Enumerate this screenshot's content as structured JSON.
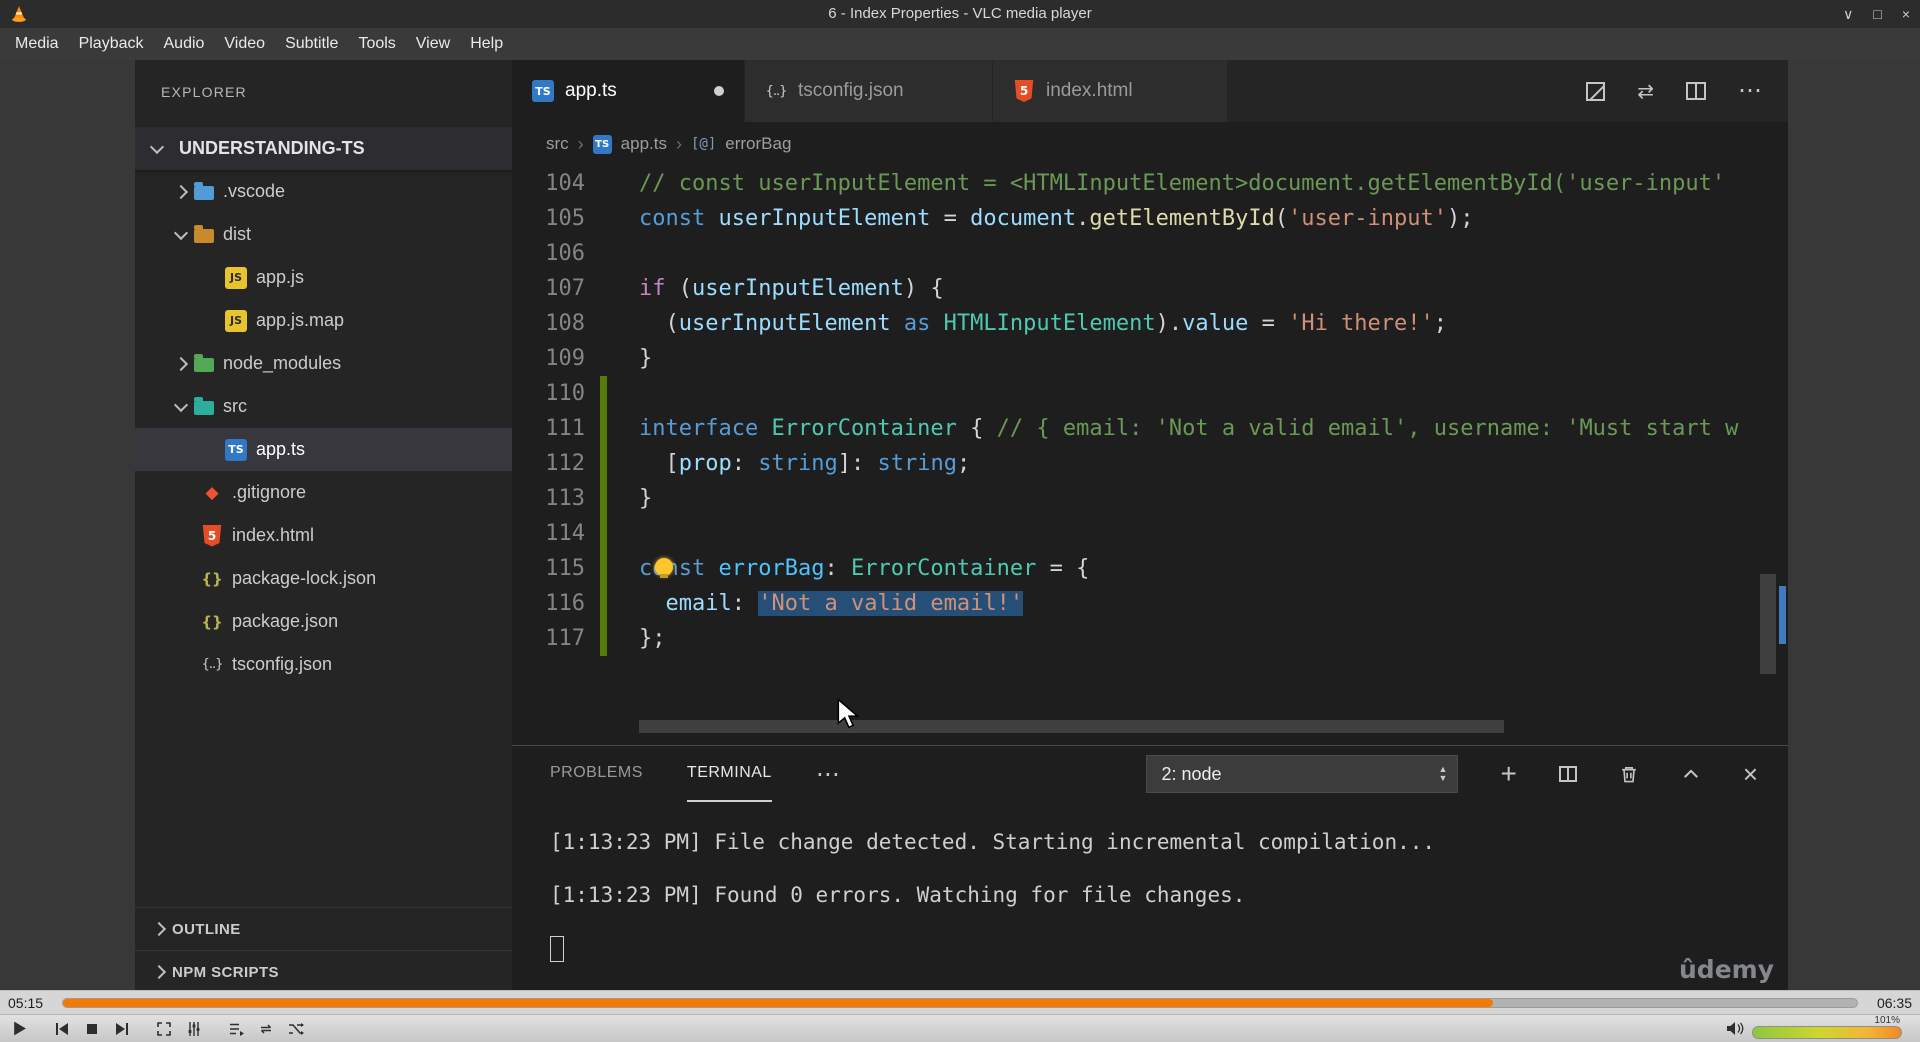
{
  "vlc": {
    "title": "6 - Index Properties - VLC media player",
    "menu_items": [
      "Media",
      "Playback",
      "Audio",
      "Video",
      "Subtitle",
      "Tools",
      "View",
      "Help"
    ],
    "time_current": "05:15",
    "time_total": "06:35",
    "progress_percent": 79.7,
    "volume_percent": "101%"
  },
  "icons": {
    "minimize_glyph": "∨",
    "maximize_glyph": "□",
    "close_glyph": "×",
    "ellipsis": "⋯",
    "compare_glyph": "⇄",
    "plus": "+",
    "spinner_up": "▲",
    "spinner_down": "▼",
    "chevron_sep": "›",
    "symbol_field": "[@]",
    "git_diamond": "◆",
    "json_braces": "{}",
    "config_braces": "{..}"
  },
  "colors": {
    "accent_orange": "#f57900",
    "selection_blue": "#264f78",
    "modified_green": "#587c0c"
  },
  "vscode": {
    "explorer": {
      "header": "EXPLORER",
      "tree": [
        {
          "label": "UNDERSTANDING-TS",
          "depth": 0,
          "root": true,
          "chevron": "down"
        },
        {
          "label": ".vscode",
          "depth": 1,
          "icon": "folder-blue",
          "chevron": "right"
        },
        {
          "label": "dist",
          "depth": 1,
          "icon": "folder-orange",
          "chevron": "down"
        },
        {
          "label": "app.js",
          "depth": 2,
          "icon": "js"
        },
        {
          "label": "app.js.map",
          "depth": 2,
          "icon": "js"
        },
        {
          "label": "node_modules",
          "depth": 1,
          "icon": "folder-green",
          "chevron": "right"
        },
        {
          "label": "src",
          "depth": 1,
          "icon": "folder-teal",
          "chevron": "down"
        },
        {
          "label": "app.ts",
          "depth": 2,
          "icon": "ts",
          "selected": true
        },
        {
          "label": ".gitignore",
          "depth": 1,
          "icon": "git"
        },
        {
          "label": "index.html",
          "depth": 1,
          "icon": "html"
        },
        {
          "label": "package-lock.json",
          "depth": 1,
          "icon": "json"
        },
        {
          "label": "package.json",
          "depth": 1,
          "icon": "json"
        },
        {
          "label": "tsconfig.json",
          "depth": 1,
          "icon": "braces"
        }
      ],
      "sections": [
        "OUTLINE",
        "NPM SCRIPTS"
      ]
    },
    "tabs": [
      {
        "label": "app.ts",
        "icon": "ts",
        "active": true,
        "modified": true
      },
      {
        "label": "tsconfig.json",
        "icon": "braces"
      },
      {
        "label": "index.html",
        "icon": "html"
      }
    ],
    "breadcrumb": [
      {
        "label": "src"
      },
      {
        "label": "app.ts",
        "icon": "ts"
      },
      {
        "label": "errorBag",
        "icon": "symbol"
      }
    ],
    "editor": {
      "lines": [
        {
          "n": "104",
          "tokens": [
            {
              "c": "comment",
              "t": "// const userInputElement = <HTMLInputElement>document.getElementById('user-input'"
            }
          ]
        },
        {
          "n": "105",
          "tokens": [
            {
              "c": "kw",
              "t": "const"
            },
            {
              "c": "plain",
              "t": " "
            },
            {
              "c": "var",
              "t": "userInputElement"
            },
            {
              "c": "plain",
              "t": " = "
            },
            {
              "c": "var",
              "t": "document"
            },
            {
              "c": "plain",
              "t": "."
            },
            {
              "c": "fn",
              "t": "getElementById"
            },
            {
              "c": "plain",
              "t": "("
            },
            {
              "c": "str",
              "t": "'user-input'"
            },
            {
              "c": "plain",
              "t": ");"
            }
          ]
        },
        {
          "n": "106",
          "tokens": []
        },
        {
          "n": "107",
          "tokens": [
            {
              "c": "ctrl",
              "t": "if"
            },
            {
              "c": "plain",
              "t": " ("
            },
            {
              "c": "var",
              "t": "userInputElement"
            },
            {
              "c": "plain",
              "t": ") {"
            }
          ]
        },
        {
          "n": "108",
          "tokens": [
            {
              "c": "plain",
              "t": "  ("
            },
            {
              "c": "var",
              "t": "userInputElement"
            },
            {
              "c": "plain",
              "t": " "
            },
            {
              "c": "kw",
              "t": "as"
            },
            {
              "c": "plain",
              "t": " "
            },
            {
              "c": "type",
              "t": "HTMLInputElement"
            },
            {
              "c": "plain",
              "t": ")."
            },
            {
              "c": "var",
              "t": "value"
            },
            {
              "c": "plain",
              "t": " = "
            },
            {
              "c": "str",
              "t": "'Hi there!'"
            },
            {
              "c": "plain",
              "t": ";"
            }
          ]
        },
        {
          "n": "109",
          "tokens": [
            {
              "c": "plain",
              "t": "}"
            }
          ]
        },
        {
          "n": "110",
          "tokens": []
        },
        {
          "n": "111",
          "tokens": [
            {
              "c": "kw",
              "t": "interface"
            },
            {
              "c": "plain",
              "t": " "
            },
            {
              "c": "type",
              "t": "ErrorContainer"
            },
            {
              "c": "plain",
              "t": " { "
            },
            {
              "c": "comment",
              "t": "// { email: 'Not a valid email', username: 'Must start w"
            }
          ]
        },
        {
          "n": "112",
          "tokens": [
            {
              "c": "plain",
              "t": "  ["
            },
            {
              "c": "var",
              "t": "prop"
            },
            {
              "c": "plain",
              "t": ": "
            },
            {
              "c": "kw",
              "t": "string"
            },
            {
              "c": "plain",
              "t": "]: "
            },
            {
              "c": "kw",
              "t": "string"
            },
            {
              "c": "plain",
              "t": ";"
            }
          ]
        },
        {
          "n": "113",
          "tokens": [
            {
              "c": "plain",
              "t": "}"
            }
          ]
        },
        {
          "n": "114",
          "tokens": []
        },
        {
          "n": "115",
          "tokens": [
            {
              "c": "kw",
              "t": "const"
            },
            {
              "c": "plain",
              "t": " "
            },
            {
              "c": "cvar",
              "t": "errorBag"
            },
            {
              "c": "plain",
              "t": ": "
            },
            {
              "c": "type",
              "t": "ErrorContainer"
            },
            {
              "c": "plain",
              "t": " = {"
            }
          ]
        },
        {
          "n": "116",
          "tokens": [
            {
              "c": "plain",
              "t": "  "
            },
            {
              "c": "var",
              "t": "email"
            },
            {
              "c": "plain",
              "t": ": "
            },
            {
              "c": "str",
              "t": "'Not a valid email!'",
              "sel": true
            }
          ]
        },
        {
          "n": "117",
          "tokens": [
            {
              "c": "plain",
              "t": "};"
            }
          ]
        }
      ]
    },
    "panel": {
      "tabs": [
        {
          "label": "PROBLEMS"
        },
        {
          "label": "TERMINAL",
          "active": true
        }
      ],
      "dropdown_value": "2: node",
      "output": [
        "[1:13:23 PM] File change detected. Starting incremental compilation...",
        "[1:13:23 PM] Found 0 errors. Watching for file changes."
      ]
    },
    "watermark": "ûdemy"
  }
}
